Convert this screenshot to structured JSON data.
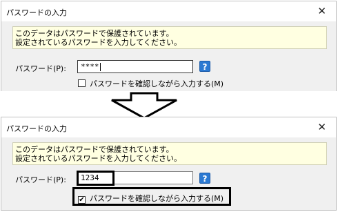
{
  "before": {
    "title": "パスワードの入力",
    "close_glyph": "✕",
    "message_line1": "このデータはパスワードで保護されています。",
    "message_line2": "設定されているパスワードを入力してください。",
    "password_label": "パスワード(P):",
    "password_value": "****",
    "help_glyph": "?",
    "show_password_label": "パスワードを確認しながら入力する(M)",
    "show_password_checked": false
  },
  "after": {
    "title": "パスワードの入力",
    "close_glyph": "✕",
    "message_line1": "このデータはパスワードで保護されています。",
    "message_line2": "設定されているパスワードを入力してください。",
    "password_label": "パスワード(P):",
    "password_value": "1234",
    "help_glyph": "?",
    "show_password_label": "パスワードを確認しながら入力する(M)",
    "show_password_checked": true,
    "check_glyph": "✔"
  },
  "colors": {
    "message_bg": "#ffffe1",
    "help_bg": "#2b79d2",
    "dialog_bg": "#f0f0f0"
  }
}
